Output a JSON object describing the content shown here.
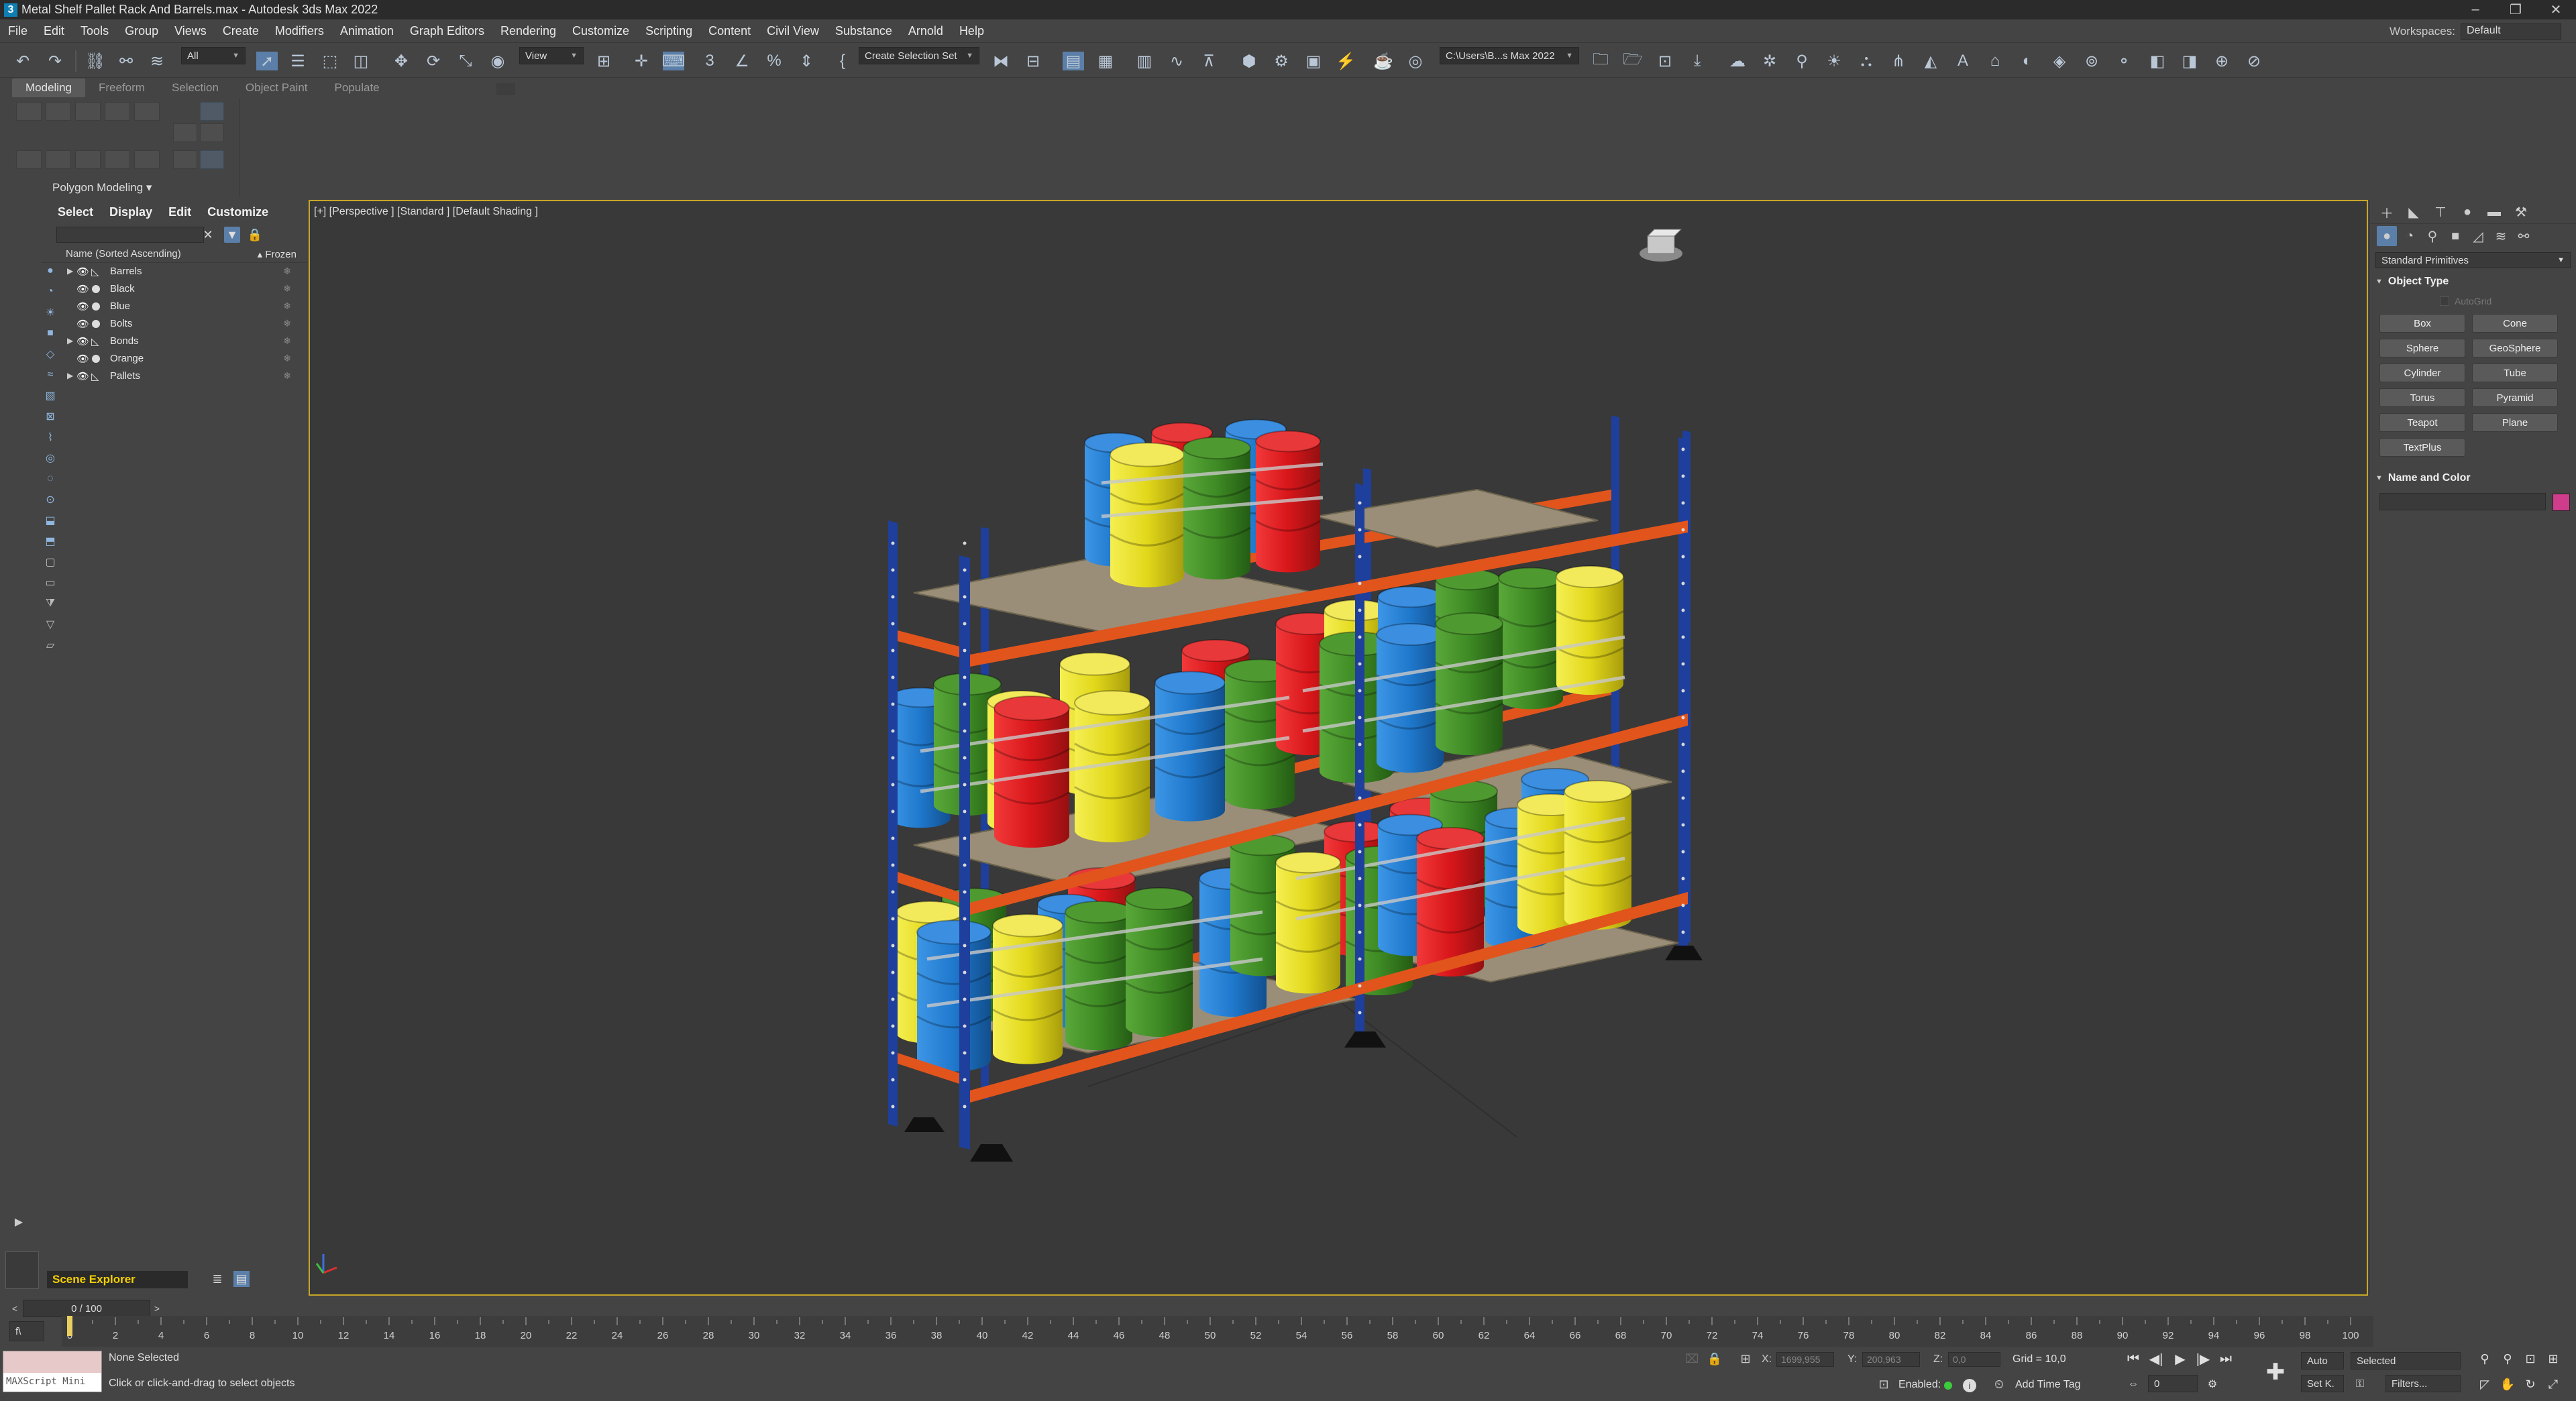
{
  "window": {
    "title": "Metal Shelf Pallet Rack And Barrels.max - Autodesk 3ds Max 2022",
    "logo": "3"
  },
  "menu": [
    "File",
    "Edit",
    "Tools",
    "Group",
    "Views",
    "Create",
    "Modifiers",
    "Animation",
    "Graph Editors",
    "Rendering",
    "Customize",
    "Scripting",
    "Content",
    "Civil View",
    "Substance",
    "Arnold",
    "Help"
  ],
  "workspaces": {
    "label": "Workspaces:",
    "value": "Default"
  },
  "toolbar": {
    "filter": "All",
    "ref_coord": "View",
    "selection_set": "Create Selection Set",
    "project_path": "C:\\Users\\B...s Max 2022"
  },
  "ribbon": {
    "tabs": [
      "Modeling",
      "Freeform",
      "Selection",
      "Object Paint",
      "Populate"
    ],
    "panel_label": "Polygon Modeling ▾"
  },
  "scene_explorer": {
    "tabs": [
      "Select",
      "Display",
      "Edit",
      "Customize"
    ],
    "column_name": "Name (Sorted Ascending)",
    "column_frozen": "▴ Frozen",
    "items": [
      {
        "label": "Barrels",
        "expandable": true,
        "icon": "group-icon"
      },
      {
        "label": "Black",
        "expandable": false,
        "icon": "geometry-icon"
      },
      {
        "label": "Blue",
        "expandable": false,
        "icon": "geometry-icon"
      },
      {
        "label": "Bolts",
        "expandable": false,
        "icon": "geometry-icon"
      },
      {
        "label": "Bonds",
        "expandable": true,
        "icon": "group-icon"
      },
      {
        "label": "Orange",
        "expandable": false,
        "icon": "geometry-icon"
      },
      {
        "label": "Pallets",
        "expandable": true,
        "icon": "group-icon"
      }
    ],
    "footer_label": "Scene Explorer"
  },
  "viewport": {
    "label": "[+] [Perspective ] [Standard ] [Default Shading ]",
    "border_color": "#c7a628"
  },
  "command_panel": {
    "category": "Standard Primitives",
    "object_type_title": "Object Type",
    "autogrid": "AutoGrid",
    "primitives": [
      "Box",
      "Cone",
      "Sphere",
      "GeoSphere",
      "Cylinder",
      "Tube",
      "Torus",
      "Pyramid",
      "Teapot",
      "Plane",
      "TextPlus"
    ],
    "name_color_title": "Name and Color",
    "swatch_color": "#cf3c8b"
  },
  "timeline": {
    "frame_display": "0 / 100",
    "ticks": [
      "0",
      "2",
      "4",
      "6",
      "8",
      "10",
      "12",
      "14",
      "16",
      "18",
      "20",
      "22",
      "24",
      "26",
      "28",
      "30",
      "32",
      "34",
      "36",
      "38",
      "40",
      "42",
      "44",
      "46",
      "48",
      "50",
      "52",
      "54",
      "56",
      "58",
      "60",
      "62",
      "64",
      "66",
      "68",
      "70",
      "72",
      "74",
      "76",
      "78",
      "80",
      "82",
      "84",
      "86",
      "88",
      "90",
      "92",
      "94",
      "96",
      "98",
      "100"
    ]
  },
  "status": {
    "maxscript_label": "MAXScript Mini",
    "selection": "None Selected",
    "prompt": "Click or click-and-drag to select objects",
    "x_label": "X:",
    "x_value": "1699,955",
    "y_label": "Y:",
    "y_value": "200,963",
    "z_label": "Z:",
    "z_value": "0,0",
    "grid": "Grid = 10,0",
    "enabled_label": "Enabled:",
    "add_time_tag": "Add Time Tag",
    "auto_key": "Auto",
    "set_key": "Set K.",
    "key_filter": "Selected",
    "filters": "Filters...",
    "current_frame": "0"
  },
  "colors": {
    "rack_blue": "#1e3f9c",
    "beam_orange": "#e1541c",
    "barrel_yellow": "#e6de1d",
    "barrel_green": "#3e8a24",
    "barrel_red": "#d8161a",
    "barrel_blue": "#1f78cc",
    "pallet": "#9a8e78"
  }
}
